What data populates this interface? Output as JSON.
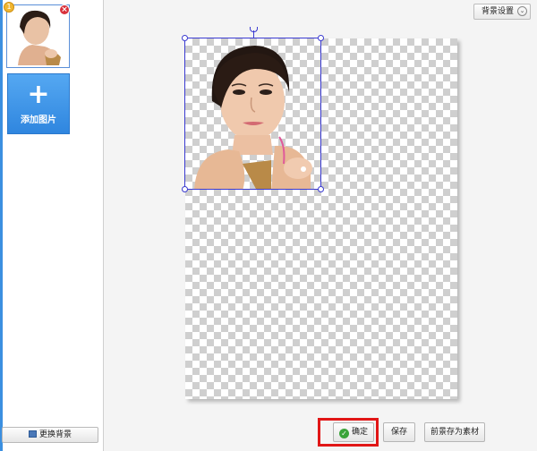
{
  "sidebar": {
    "thumbnail": {
      "badge": "1",
      "close_glyph": "×",
      "icon": "photo-thumbnail"
    },
    "add_image": {
      "plus_glyph": "+",
      "label": "添加图片"
    },
    "change_background_label": "更换背景"
  },
  "toolbar": {
    "background_settings_label": "背景设置",
    "chevron_glyph": "⌄"
  },
  "footer": {
    "confirm_label": "确定",
    "save_label": "保存",
    "save_foreground_label": "前景存为素材"
  },
  "colors": {
    "accent_blue": "#3b8fe0",
    "selection_border": "#3a3ad0",
    "highlight_red": "#e11616",
    "confirm_check_green": "#3aa33a"
  }
}
